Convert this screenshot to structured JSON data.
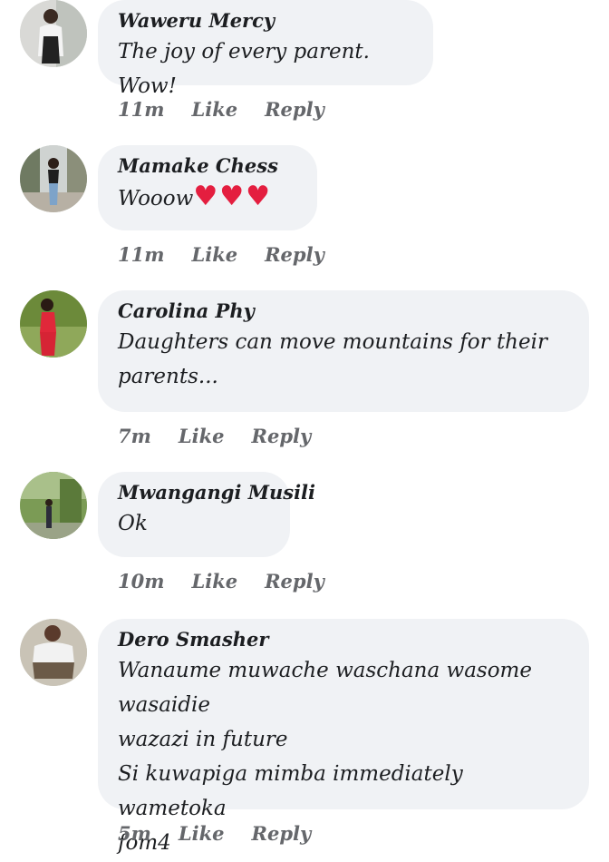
{
  "colors": {
    "bubble": "#f0f2f5",
    "meta": "#65676b",
    "heart": "#e41e3f"
  },
  "comments": [
    {
      "author": "Waweru Mercy",
      "text": "The joy of every parent. Wow!",
      "time": "11m",
      "like": "Like",
      "reply": "Reply"
    },
    {
      "author": "Mamake Chess",
      "text": "Wooow",
      "hearts": "♥♥♥",
      "time": "11m",
      "like": "Like",
      "reply": "Reply"
    },
    {
      "author": "Carolina Phy",
      "text_lines": [
        "Daughters can move mountains for their",
        "parents..."
      ],
      "time": "7m",
      "like": "Like",
      "reply": "Reply"
    },
    {
      "author": "Mwangangi Musili",
      "text": "Ok",
      "time": "10m",
      "like": "Like",
      "reply": "Reply"
    },
    {
      "author": "Dero Smasher",
      "text_lines": [
        "Wanaume muwache waschana wasome wasaidie",
        "wazazi in future",
        "Si kuwapiga mimba immediately wametoka",
        "fom4"
      ],
      "time": "5m",
      "like": "Like",
      "reply": "Reply"
    }
  ]
}
